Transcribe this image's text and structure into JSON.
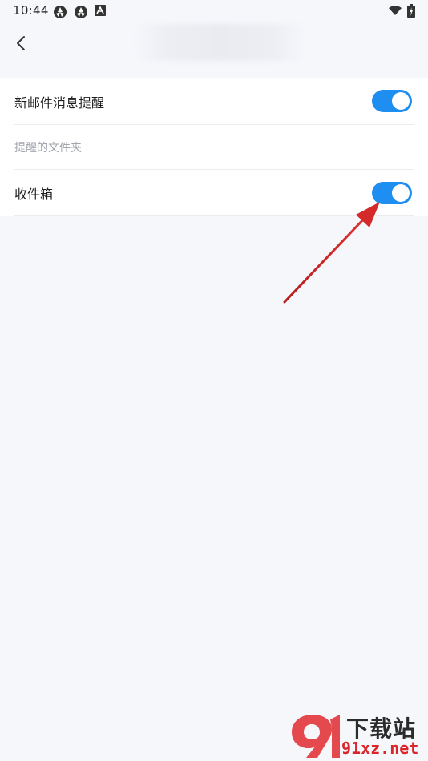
{
  "status_bar": {
    "time": "10:44",
    "left_icons": [
      "aperture-icon",
      "aperture-icon",
      "app-a-icon"
    ],
    "right_icons": [
      "wifi-icon",
      "battery-charging-icon"
    ]
  },
  "header": {
    "back_icon": "chevron-left-icon",
    "title": ""
  },
  "settings": {
    "new_mail_notification": {
      "label": "新邮件消息提醒",
      "enabled": true
    },
    "folder_section_hint": "提醒的文件夹",
    "inbox": {
      "label": "收件箱",
      "enabled": true
    }
  },
  "colors": {
    "toggle_on": "#1f8ef1",
    "background": "#f5f7fb",
    "annotation_arrow": "#d42a2a"
  },
  "watermark": {
    "title": "下载站",
    "domain": "91xz.net"
  }
}
